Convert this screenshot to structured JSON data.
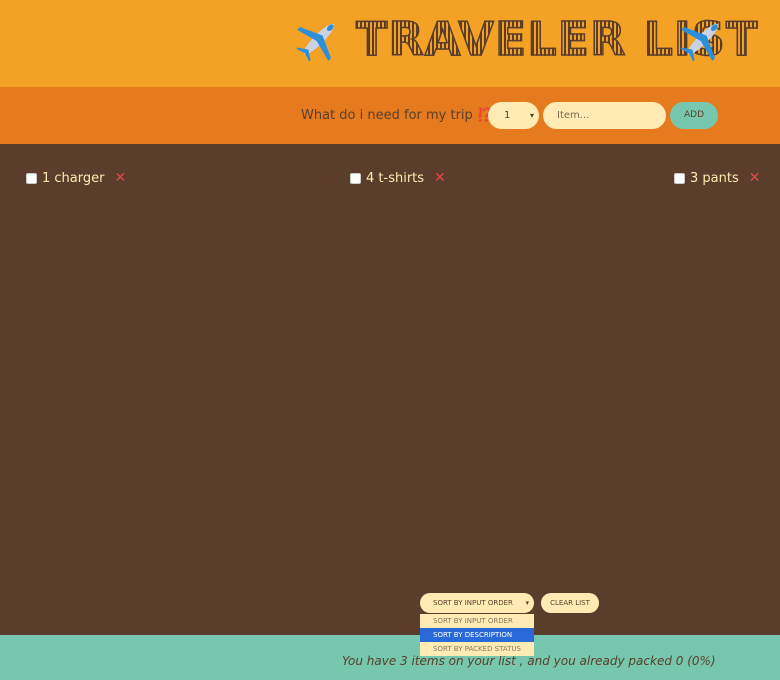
{
  "header": {
    "title": "TRAVELER LIST",
    "left_icon": "airplane-icon",
    "right_icon": "airplane-icon"
  },
  "form": {
    "question": "What do i need for my trip ⁉️",
    "emoji_icon": "thinking-face-icon",
    "quantity_value": "1",
    "item_placeholder": "Item...",
    "add_label": "ADD"
  },
  "items": [
    {
      "quantity": 1,
      "description": "charger",
      "label": "1 charger",
      "packed": false
    },
    {
      "quantity": 4,
      "description": "t-shirts",
      "label": "4 t-shirts",
      "packed": false
    },
    {
      "quantity": 3,
      "description": "pants",
      "label": "3 pants",
      "packed": false
    }
  ],
  "delete_glyph": "❌",
  "actions": {
    "sort_selected": "SORT BY INPUT ORDER",
    "sort_options": [
      "SORT BY INPUT ORDER",
      "SORT BY DESCRIPTION",
      "SORT BY PACKED STATUS"
    ],
    "highlighted_option": "SORT BY DESCRIPTION",
    "clear_label": "CLEAR LIST"
  },
  "stats": {
    "text": "You have 3 items on your list , and you already packed 0 (0%)"
  },
  "colors": {
    "header_bg": "#f4a226",
    "form_bg": "#e67a1e",
    "list_bg": "#5a3e2b",
    "footer_bg": "#76c7ad",
    "input_bg": "#ffebb3",
    "delete": "#e5484d"
  }
}
